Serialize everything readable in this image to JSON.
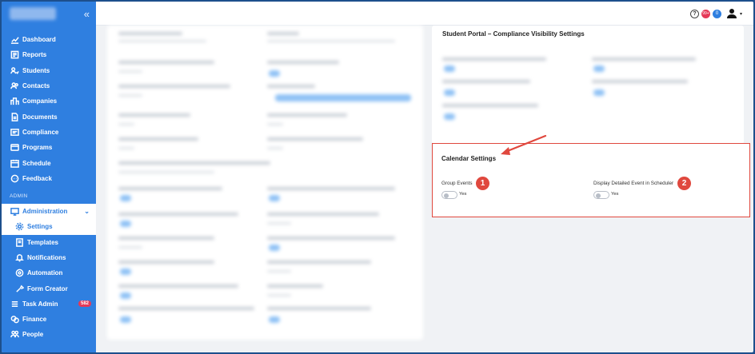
{
  "sidebar": {
    "collapse_icon": "double-chevron-left-icon",
    "items": [
      {
        "label": "Dashboard",
        "icon": "chart-line-icon"
      },
      {
        "label": "Reports",
        "icon": "report-icon"
      },
      {
        "label": "Students",
        "icon": "students-icon"
      },
      {
        "label": "Contacts",
        "icon": "contacts-icon"
      },
      {
        "label": "Companies",
        "icon": "companies-icon"
      },
      {
        "label": "Documents",
        "icon": "document-icon"
      },
      {
        "label": "Compliance",
        "icon": "compliance-icon"
      },
      {
        "label": "Programs",
        "icon": "programs-icon"
      },
      {
        "label": "Schedule",
        "icon": "calendar-icon"
      },
      {
        "label": "Feedback",
        "icon": "feedback-icon"
      }
    ],
    "section_admin": "ADMIN",
    "admin": {
      "label": "Administration",
      "icon": "admin-icon"
    },
    "admin_sub": [
      {
        "label": "Settings",
        "icon": "gear-icon"
      },
      {
        "label": "Templates",
        "icon": "template-icon"
      },
      {
        "label": "Notifications",
        "icon": "bell-icon"
      },
      {
        "label": "Automation",
        "icon": "automation-icon"
      },
      {
        "label": "Form Creator",
        "icon": "form-creator-icon"
      }
    ],
    "bottom_items": [
      {
        "label": "Task Admin",
        "icon": "task-icon",
        "badge": "582"
      },
      {
        "label": "Finance",
        "icon": "finance-icon"
      },
      {
        "label": "People",
        "icon": "people-icon"
      }
    ]
  },
  "topbar": {
    "help_glyph": "?",
    "notif_pink": "99+",
    "notif_blue": "0"
  },
  "portal": {
    "title": "Student Portal – Compliance Visibility Settings"
  },
  "calendar": {
    "title": "Calendar Settings",
    "settings": [
      {
        "label": "Group Events",
        "toggle_text": "Yes",
        "marker": "1"
      },
      {
        "label": "Display Detailed Event in Scheduler",
        "toggle_text": "Yes",
        "marker": "2"
      }
    ]
  },
  "colors": {
    "sidebar": "#2f7fe0",
    "highlight": "#e0483e"
  }
}
